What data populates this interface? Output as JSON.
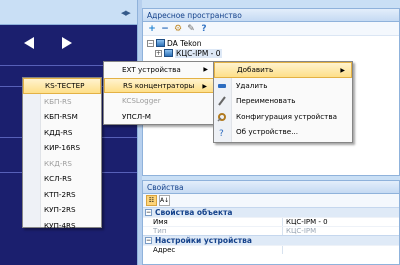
{
  "addr_panel": {
    "title": "Адресное пространство"
  },
  "tree": {
    "root_label": "DA Tekon",
    "child_label": "КЦС-IPM - 0"
  },
  "props_panel": {
    "title": "Свойства",
    "categories": [
      {
        "name": "Свойства объекта",
        "rows": [
          {
            "name": "Имя",
            "value": "КЦС-IPM - 0",
            "muted": false
          },
          {
            "name": "Тип",
            "value": "КЦС-IPM",
            "muted": true
          }
        ]
      },
      {
        "name": "Настройки устройства",
        "rows": [
          {
            "name": "Адрес",
            "value": "",
            "muted": false
          }
        ]
      }
    ]
  },
  "menu_devices": [
    {
      "label": "КS-ТЕСТЕР",
      "highlighted": true,
      "disabled": false
    },
    {
      "label": "КБП-RS",
      "highlighted": false,
      "disabled": true
    },
    {
      "label": "КБП-RSM",
      "highlighted": false,
      "disabled": false
    },
    {
      "label": "КДД-RS",
      "highlighted": false,
      "disabled": false
    },
    {
      "label": "КИР-16RS",
      "highlighted": false,
      "disabled": false
    },
    {
      "label": "ККД-RS",
      "highlighted": false,
      "disabled": true
    },
    {
      "label": "КСЛ-RS",
      "highlighted": false,
      "disabled": false
    },
    {
      "label": "КТП-2RS",
      "highlighted": false,
      "disabled": false
    },
    {
      "label": "КУП-2RS",
      "highlighted": false,
      "disabled": false
    },
    {
      "label": "КУП-4RS",
      "highlighted": false,
      "disabled": false
    }
  ],
  "menu_types": [
    {
      "label": "EXT устройства",
      "has_submenu": true,
      "highlighted": false,
      "disabled": false
    },
    {
      "label": "RS концентраторы",
      "has_submenu": true,
      "highlighted": true,
      "disabled": false
    },
    {
      "label": "KCSLogger",
      "has_submenu": false,
      "highlighted": false,
      "disabled": true
    },
    {
      "label": "УПСЛ-М",
      "has_submenu": false,
      "highlighted": false,
      "disabled": false
    }
  ],
  "menu_actions": [
    {
      "label": "Добавить",
      "icon": "add-icon",
      "has_submenu": true,
      "highlighted": true
    },
    {
      "label": "Удалить",
      "icon": "delete-icon",
      "has_submenu": false,
      "highlighted": false
    },
    {
      "label": "Переименовать",
      "icon": "rename-icon",
      "has_submenu": false,
      "highlighted": false
    },
    {
      "label": "Конфигурация устройства",
      "icon": "config-icon",
      "has_submenu": false,
      "highlighted": false
    },
    {
      "label": "Об устройстве...",
      "icon": "help-icon",
      "has_submenu": false,
      "highlighted": false
    }
  ]
}
